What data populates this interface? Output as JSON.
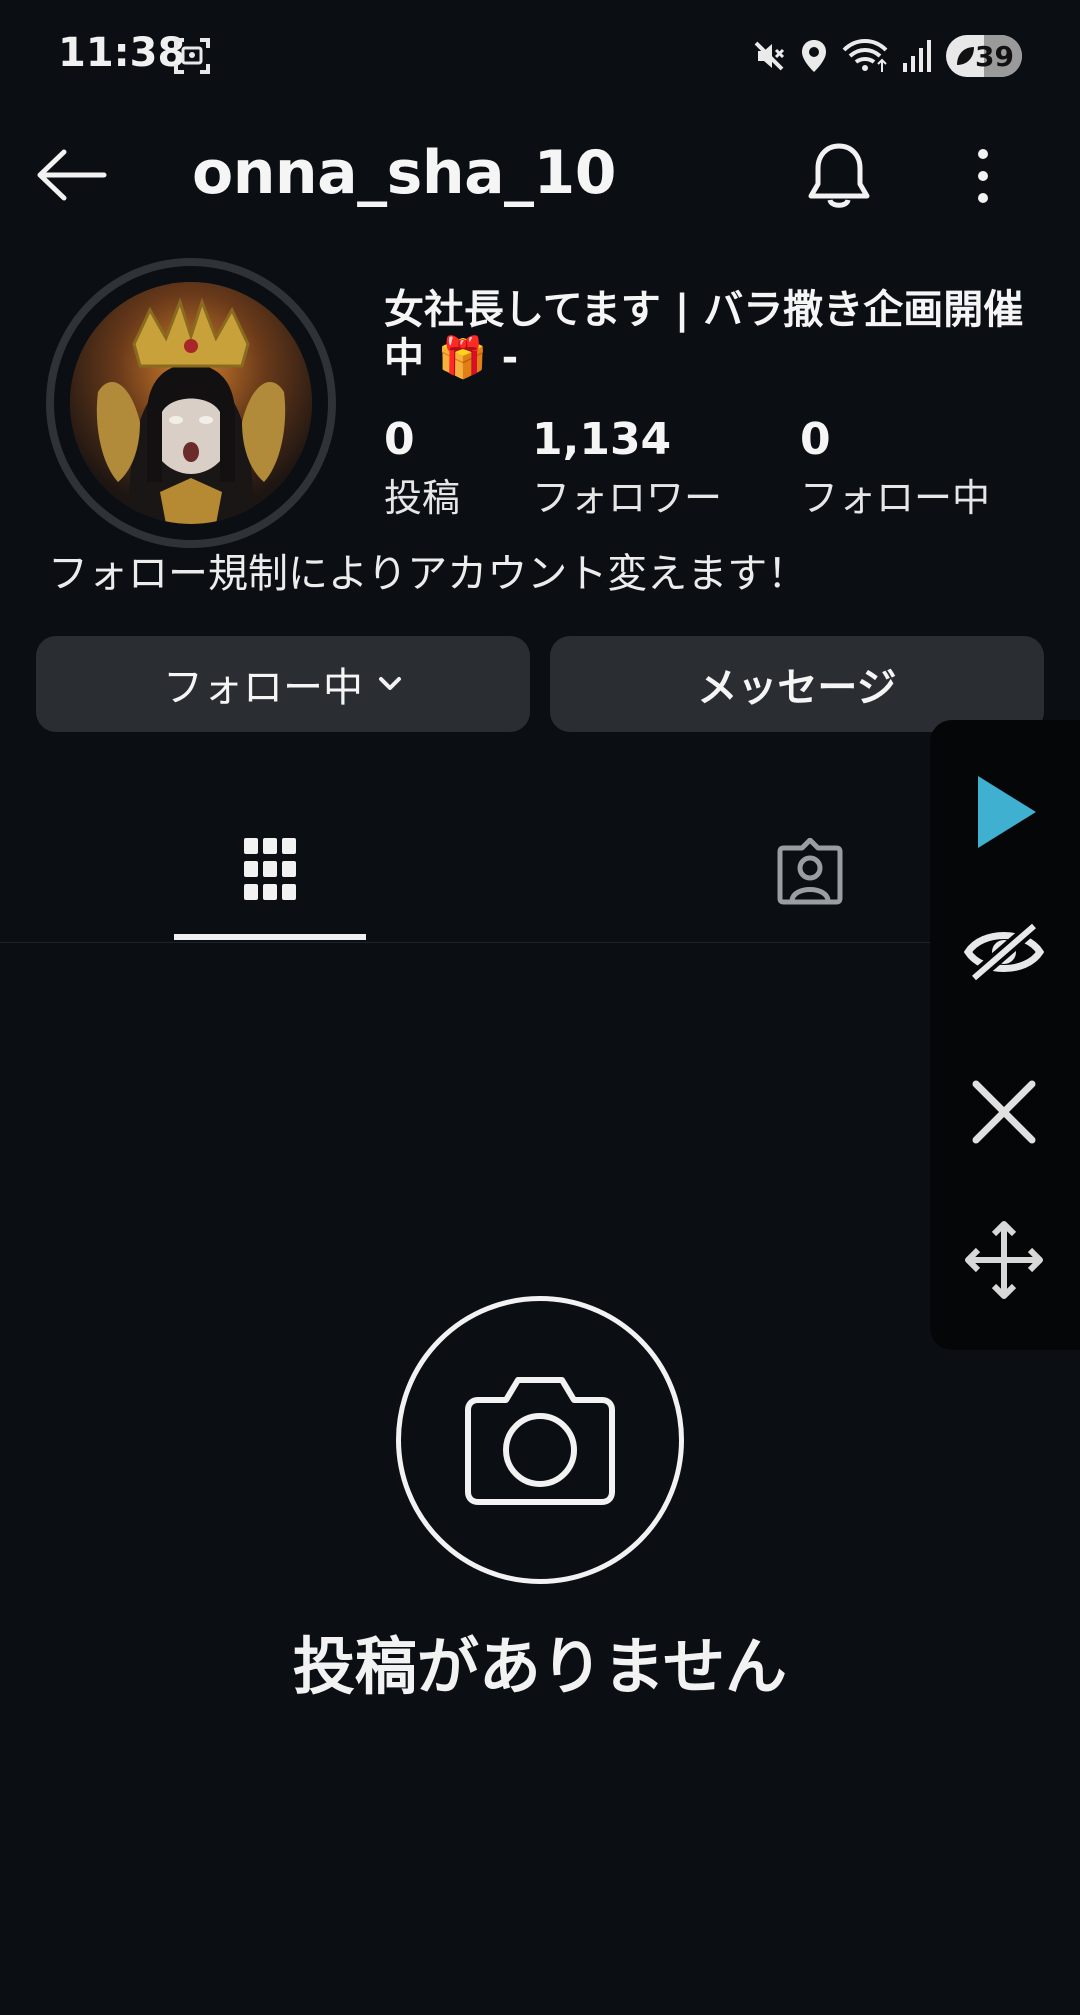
{
  "status_bar": {
    "time": "11:38",
    "battery": "39",
    "icons": [
      "screenshot-icon",
      "mute-icon",
      "location-icon",
      "wifi-icon",
      "signal-icon",
      "battery-icon"
    ]
  },
  "header": {
    "username": "onna_sha_10",
    "icons": [
      "back-arrow-icon",
      "bell-icon",
      "more-vertical-icon"
    ]
  },
  "profile": {
    "display_name": "女社長してます | バラ撒き企画開催中 🎁 -",
    "stats": [
      {
        "value": "0",
        "label": "投稿"
      },
      {
        "value": "1,134",
        "label": "フォロワー"
      },
      {
        "value": "0",
        "label": "フォロー中"
      }
    ],
    "bio": "フォロー規制によりアカウント変えます！"
  },
  "buttons": {
    "following": "フォロー中",
    "message": "メッセージ"
  },
  "tabs": [
    {
      "name": "posts",
      "icon": "grid-icon",
      "active": true
    },
    {
      "name": "tagged",
      "icon": "tagged-person-icon",
      "active": false
    }
  ],
  "overlay_controls": [
    "play-icon",
    "hide-eye-icon",
    "close-icon",
    "move-icon"
  ],
  "empty_state": {
    "icon": "camera-icon",
    "text": "投稿がありません"
  },
  "colors": {
    "background": "#0b0f14",
    "button": "#2a2e33",
    "accent_play": "#3fb0d0"
  }
}
